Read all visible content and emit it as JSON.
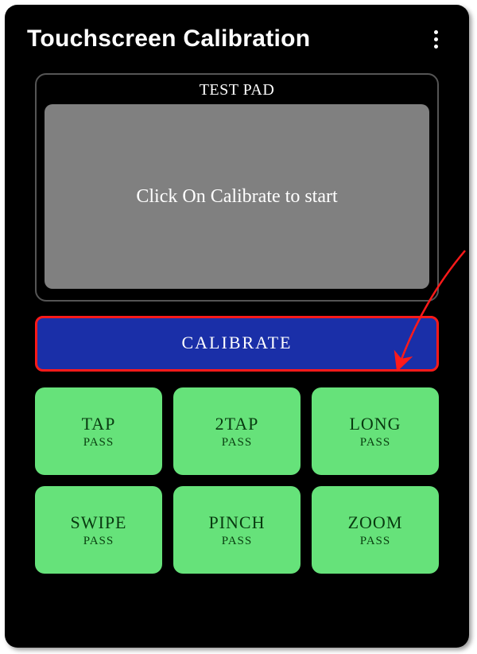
{
  "header": {
    "title": "Touchscreen Calibration"
  },
  "testpad": {
    "label": "TEST PAD",
    "message": "Click On Calibrate to start"
  },
  "calibrate": {
    "label": "CALIBRATE"
  },
  "tiles": [
    {
      "title": "TAP",
      "status": "PASS"
    },
    {
      "title": "2TAP",
      "status": "PASS"
    },
    {
      "title": "LONG",
      "status": "PASS"
    },
    {
      "title": "SWIPE",
      "status": "PASS"
    },
    {
      "title": "PINCH",
      "status": "PASS"
    },
    {
      "title": "ZOOM",
      "status": "PASS"
    }
  ],
  "colors": {
    "accent_blue": "#1a2fa8",
    "tile_green": "#66e27a",
    "highlight_red": "#ff1a1a"
  }
}
